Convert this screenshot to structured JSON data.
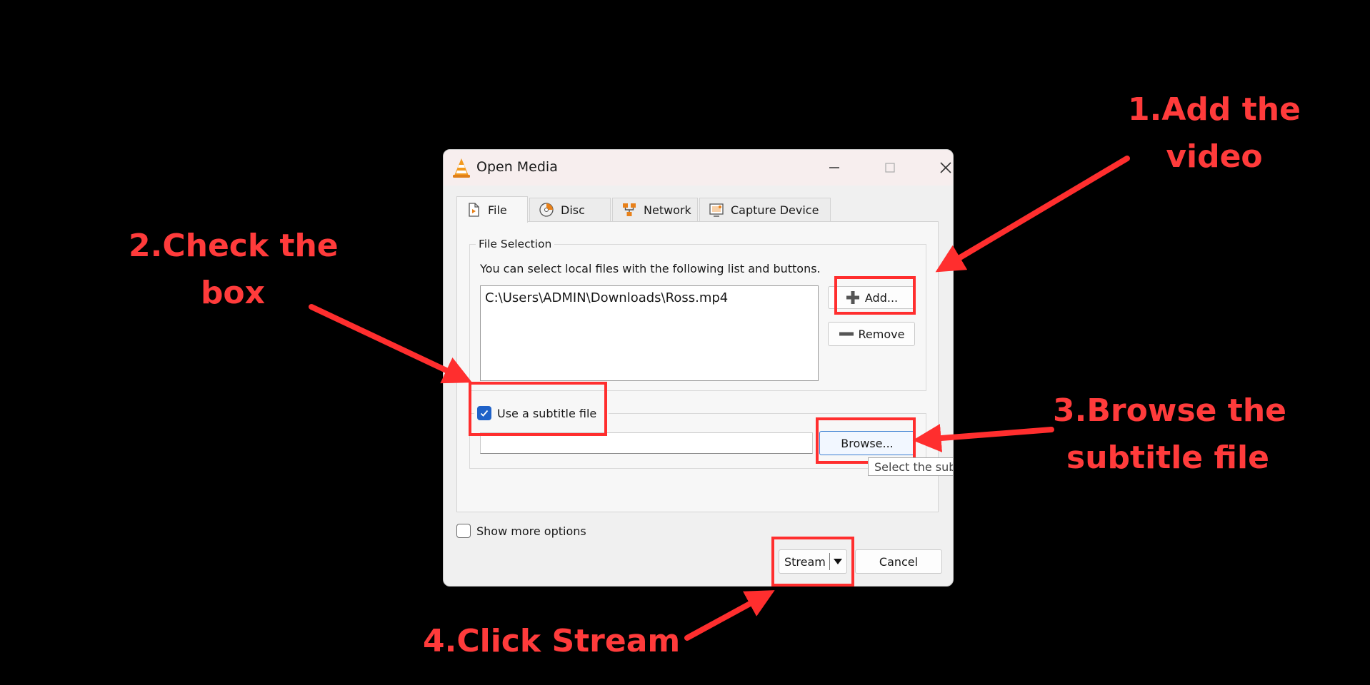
{
  "annotations": {
    "step1": [
      "1.Add the",
      "video"
    ],
    "step2": [
      "2.Check the",
      "box"
    ],
    "step3": [
      "3.Browse the",
      "subtitle file"
    ],
    "step4": "4.Click Stream",
    "color": "#ff3b3b"
  },
  "window": {
    "title": "Open Media",
    "icon": "vlc-cone-icon",
    "controls": [
      "minimize-icon",
      "maximize-icon",
      "close-icon"
    ]
  },
  "tabs": [
    {
      "label": "File",
      "icon": "file-icon",
      "active": true
    },
    {
      "label": "Disc",
      "icon": "disc-icon",
      "active": false
    },
    {
      "label": "Network",
      "icon": "network-icon",
      "active": false
    },
    {
      "label": "Capture Device",
      "icon": "capture-device-icon",
      "active": false
    }
  ],
  "file_selection": {
    "group_label": "File Selection",
    "hint": "You can select local files with the following list and buttons.",
    "files": [
      "C:\\Users\\ADMIN\\Downloads\\Ross.mp4"
    ],
    "add_label": "Add...",
    "remove_label": "Remove"
  },
  "subtitle": {
    "checkbox_label": "Use a subtitle file",
    "checked": true,
    "path_value": "",
    "browse_label": "Browse...",
    "tooltip": "Select the subtitle file"
  },
  "footer": {
    "show_more_label": "Show more options",
    "show_more_checked": false,
    "stream_label": "Stream",
    "cancel_label": "Cancel"
  },
  "colors": {
    "background": "#000000",
    "annotation_red": "#ff2e2e",
    "checkbox_blue": "#1f62c8",
    "dialog_bg": "#f0f0f0"
  }
}
